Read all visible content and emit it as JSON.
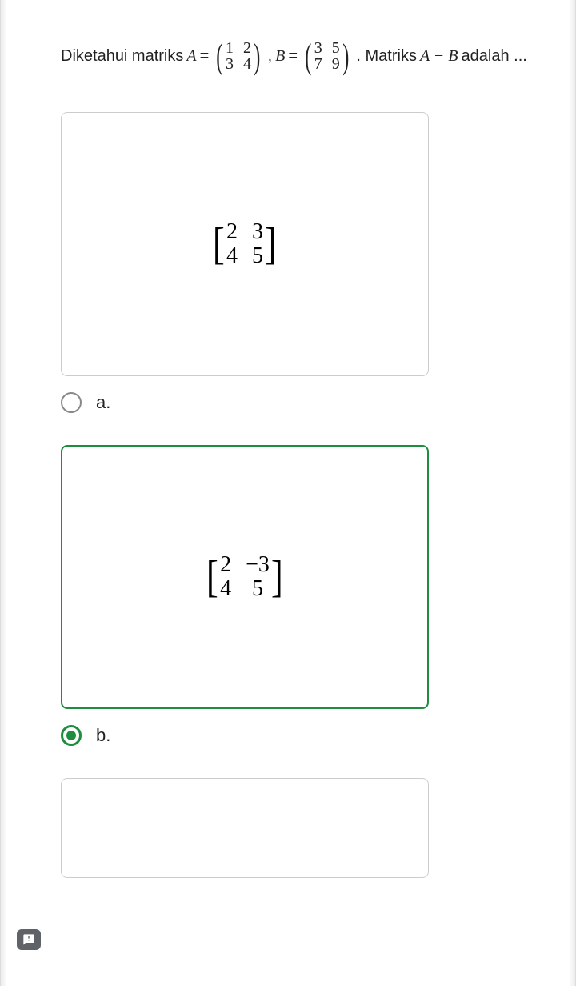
{
  "question": {
    "prefix": "Diketahui matriks ",
    "varA": "A",
    "eq1": " = ",
    "matA": [
      "1",
      "2",
      "3",
      "4"
    ],
    "comma": ", ",
    "varB": "B",
    "eq2": " = ",
    "matB": [
      "3",
      "5",
      "7",
      "9"
    ],
    "suffix": ". Matriks ",
    "expr": "A − B",
    "tail": " adalah ..."
  },
  "options": {
    "a": {
      "label": "a.",
      "matrix": [
        "2",
        "3",
        "4",
        "5"
      ],
      "selected": false
    },
    "b": {
      "label": "b.",
      "matrix": [
        "2",
        "−3",
        "4",
        "5"
      ],
      "selected": true
    }
  }
}
